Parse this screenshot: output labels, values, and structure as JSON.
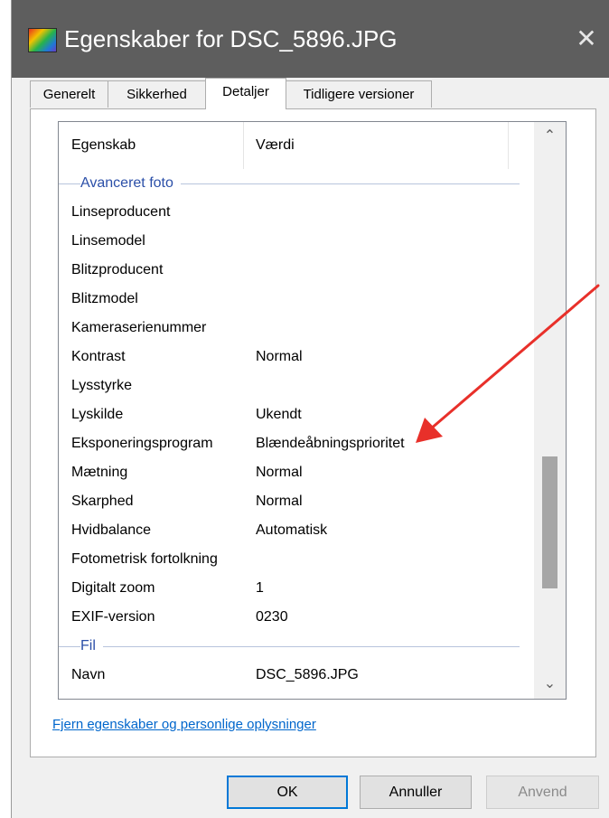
{
  "window": {
    "title": "Egenskaber for DSC_5896.JPG",
    "close_glyph": "✕"
  },
  "tabs": [
    {
      "label": "Generelt"
    },
    {
      "label": "Sikkerhed"
    },
    {
      "label": "Detaljer",
      "active": true
    },
    {
      "label": "Tidligere versioner"
    }
  ],
  "list": {
    "columns": {
      "property": "Egenskab",
      "value": "Værdi"
    },
    "groups": [
      {
        "title": "Avanceret foto",
        "rows": [
          {
            "key": "Linseproducent",
            "value": ""
          },
          {
            "key": "Linsemodel",
            "value": ""
          },
          {
            "key": "Blitzproducent",
            "value": ""
          },
          {
            "key": "Blitzmodel",
            "value": ""
          },
          {
            "key": "Kameraserienummer",
            "value": ""
          },
          {
            "key": "Kontrast",
            "value": "Normal"
          },
          {
            "key": "Lysstyrke",
            "value": ""
          },
          {
            "key": "Lyskilde",
            "value": "Ukendt"
          },
          {
            "key": "Eksponeringsprogram",
            "value": "Blændeåbningsprioritet"
          },
          {
            "key": "Mætning",
            "value": "Normal"
          },
          {
            "key": "Skarphed",
            "value": "Normal"
          },
          {
            "key": "Hvidbalance",
            "value": "Automatisk"
          },
          {
            "key": "Fotometrisk fortolkning",
            "value": ""
          },
          {
            "key": "Digitalt zoom",
            "value": "1"
          },
          {
            "key": "EXIF-version",
            "value": "0230"
          }
        ]
      },
      {
        "title": "Fil",
        "rows": [
          {
            "key": "Navn",
            "value": "DSC_5896.JPG"
          }
        ]
      }
    ]
  },
  "scrollbar": {
    "up_glyph": "⌃",
    "down_glyph": "⌄"
  },
  "remove_link": "Fjern egenskaber og personlige oplysninger",
  "buttons": {
    "ok": "OK",
    "cancel": "Annuller",
    "apply": "Anvend"
  },
  "colors": {
    "titlebar": "#5e5e5e",
    "link": "#0066cc",
    "group_header": "#2b4fa8",
    "annotation_arrow": "#e8302a"
  }
}
